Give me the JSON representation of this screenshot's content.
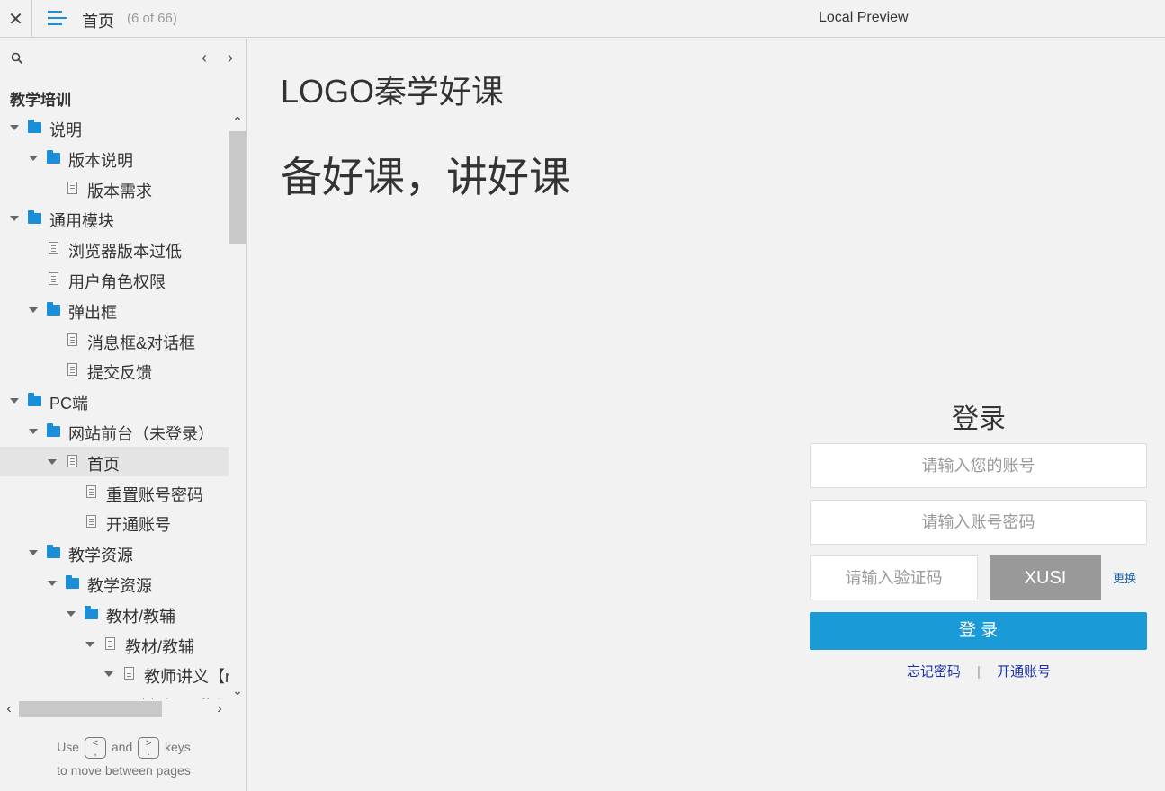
{
  "topbar": {
    "close_glyph": "✕",
    "page_title": "首页",
    "page_count": "(6 of 66)",
    "preview_label": "Local Preview"
  },
  "sidebar": {
    "nav_prev_glyph": "‹",
    "nav_next_glyph": "›",
    "project_name": "教学培训",
    "tree": [
      {
        "label": "说明",
        "type": "folder",
        "level": 0,
        "expanded": true
      },
      {
        "label": "版本说明",
        "type": "folder",
        "level": 1,
        "expanded": true
      },
      {
        "label": "版本需求",
        "type": "page",
        "level": 2
      },
      {
        "label": "通用模块",
        "type": "folder",
        "level": 0,
        "expanded": true
      },
      {
        "label": "浏览器版本过低",
        "type": "page",
        "level": 1
      },
      {
        "label": "用户角色权限",
        "type": "page",
        "level": 1
      },
      {
        "label": "弹出框",
        "type": "folder",
        "level": 1,
        "expanded": true
      },
      {
        "label": "消息框&对话框",
        "type": "page",
        "level": 2
      },
      {
        "label": "提交反馈",
        "type": "page",
        "level": 2
      },
      {
        "label": "PC端",
        "type": "folder",
        "level": 0,
        "expanded": true
      },
      {
        "label": "网站前台（未登录）",
        "type": "folder",
        "level": 1,
        "expanded": true
      },
      {
        "label": "首页",
        "type": "page",
        "level": 2,
        "expanded": true,
        "selected": true
      },
      {
        "label": "重置账号密码",
        "type": "page",
        "level": 3
      },
      {
        "label": "开通账号",
        "type": "page",
        "level": 3
      },
      {
        "label": "教学资源",
        "type": "folder",
        "level": 1,
        "expanded": true
      },
      {
        "label": "教学资源",
        "type": "folder",
        "level": 2,
        "expanded": true
      },
      {
        "label": "教材/教辅",
        "type": "folder",
        "level": 3,
        "expanded": true
      },
      {
        "label": "教材/教辅",
        "type": "page",
        "level": 4,
        "expanded": true
      },
      {
        "label": "教师讲义【r",
        "type": "page",
        "level": 5,
        "expanded": true
      },
      {
        "label": "打印讲义",
        "type": "page",
        "level": 6
      }
    ],
    "hint": {
      "use": "Use",
      "key_prev": "<\n,",
      "and": "and",
      "key_next": ">\n.",
      "keys": "keys",
      "line2": "to move between pages"
    }
  },
  "main": {
    "logo": "LOGO秦学好课",
    "slogan": "备好课，讲好课",
    "login": {
      "title": "登录",
      "username_placeholder": "请输入您的账号",
      "password_placeholder": "请输入账号密码",
      "captcha_placeholder": "请输入验证码",
      "captcha_text": "XUSI",
      "change_label": "更换",
      "submit_label": "登 录",
      "forgot_label": "忘记密码",
      "separator": "|",
      "register_label": "开通账号"
    }
  },
  "colors": {
    "accent": "#1a8ed8",
    "login_button": "#1a9ad6",
    "captcha_bg": "#999999",
    "link": "#1a2fa8"
  }
}
